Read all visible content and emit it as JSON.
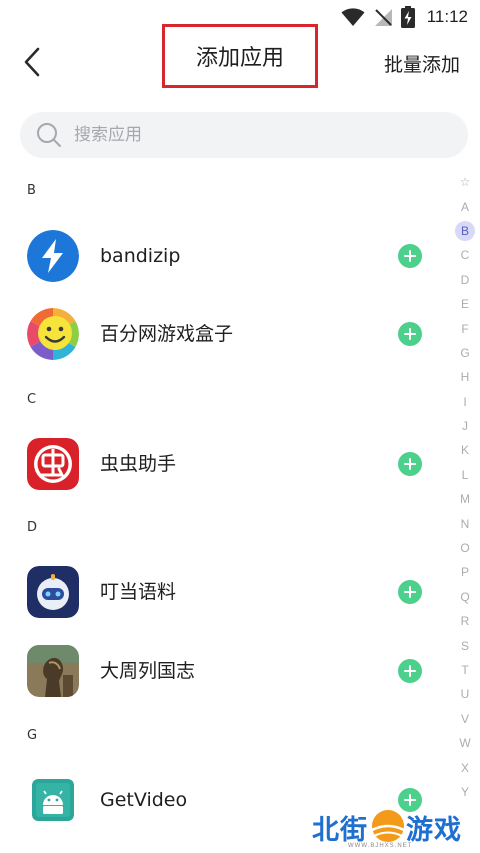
{
  "status_bar": {
    "time": "11:12"
  },
  "header": {
    "title": "添加应用",
    "batch_add": "批量添加"
  },
  "search": {
    "placeholder": "搜索应用"
  },
  "sections": [
    {
      "letter": "B",
      "items": [
        {
          "name": "bandizip",
          "icon": "bandizip-lightning-icon"
        },
        {
          "name": "百分网游戏盒子",
          "icon": "smiley-face-icon"
        }
      ]
    },
    {
      "letter": "C",
      "items": [
        {
          "name": "虫虫助手",
          "icon": "chongchong-icon"
        }
      ]
    },
    {
      "letter": "D",
      "items": [
        {
          "name": "叮当语料",
          "icon": "dingdang-robot-icon"
        },
        {
          "name": "大周列国志",
          "icon": "statue-icon"
        }
      ]
    },
    {
      "letter": "G",
      "items": [
        {
          "name": "GetVideo",
          "icon": "android-robot-icon"
        }
      ]
    }
  ],
  "index_bar": {
    "letters": [
      "☆",
      "A",
      "B",
      "C",
      "D",
      "E",
      "F",
      "G",
      "H",
      "I",
      "J",
      "K",
      "L",
      "M",
      "N",
      "O",
      "P",
      "Q",
      "R",
      "S",
      "T",
      "U",
      "V",
      "W",
      "X",
      "Y"
    ],
    "active": "B"
  },
  "watermark": {
    "brand_left": "北街",
    "brand_right": "游戏",
    "url": "WWW.BJHXS.NET"
  },
  "colors": {
    "add_button": "#4cd08c",
    "highlight_box": "#d9262c",
    "index_active_bg": "#d7d9f7"
  }
}
